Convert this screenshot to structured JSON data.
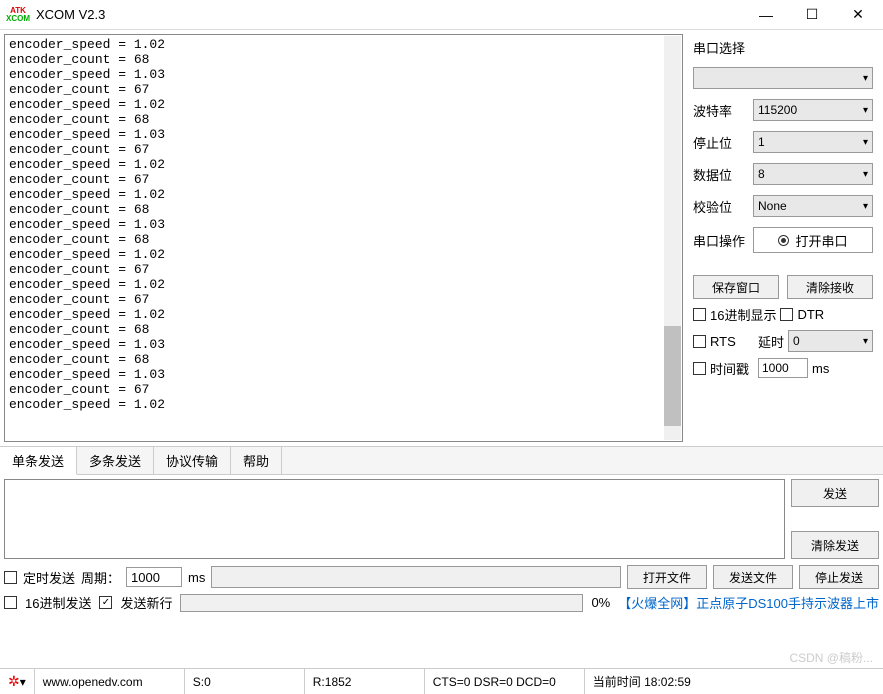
{
  "window": {
    "title": "XCOM V2.3"
  },
  "terminal_lines": [
    "encoder_speed = 1.02",
    "encoder_count = 68",
    "encoder_speed = 1.03",
    "encoder_count = 67",
    "encoder_speed = 1.02",
    "encoder_count = 68",
    "encoder_speed = 1.03",
    "encoder_count = 67",
    "encoder_speed = 1.02",
    "encoder_count = 67",
    "encoder_speed = 1.02",
    "encoder_count = 68",
    "encoder_speed = 1.03",
    "encoder_count = 68",
    "encoder_speed = 1.02",
    "encoder_count = 67",
    "encoder_speed = 1.02",
    "encoder_count = 67",
    "encoder_speed = 1.02",
    "encoder_count = 68",
    "encoder_speed = 1.03",
    "encoder_count = 68",
    "encoder_speed = 1.03",
    "encoder_count = 67",
    "encoder_speed = 1.02"
  ],
  "sidebar": {
    "port_label": "串口选择",
    "port_value": "",
    "baud_label": "波特率",
    "baud_value": "115200",
    "stop_label": "停止位",
    "stop_value": "1",
    "data_label": "数据位",
    "data_value": "8",
    "parity_label": "校验位",
    "parity_value": "None",
    "op_label": "串口操作",
    "op_button": "打开串口",
    "save_btn": "保存窗口",
    "clear_btn": "清除接收",
    "hex_disp": "16进制显示",
    "dtr": "DTR",
    "rts": "RTS",
    "delay_label": "延时",
    "delay_value": "0",
    "timestamp": "时间戳",
    "ts_value": "1000",
    "ts_unit": "ms"
  },
  "tabs": {
    "t1": "单条发送",
    "t2": "多条发送",
    "t3": "协议传输",
    "t4": "帮助"
  },
  "send": {
    "send_btn": "发送",
    "clear_btn": "清除发送",
    "timed": "定时发送",
    "period_label": "周期：",
    "period_value": "1000",
    "period_unit": "ms",
    "open_file": "打开文件",
    "send_file": "发送文件",
    "stop_send": "停止发送",
    "hex_send": "16进制发送",
    "newline": "发送新行",
    "progress_pct": "0%",
    "promo": "【火爆全网】正点原子DS100手持示波器上市"
  },
  "status": {
    "url": "www.openedv.com",
    "s": "S:0",
    "r": "R:1852",
    "signals": "CTS=0 DSR=0 DCD=0",
    "time_label": "当前时间 18:02:59"
  },
  "watermark": "CSDN @稿粉..."
}
